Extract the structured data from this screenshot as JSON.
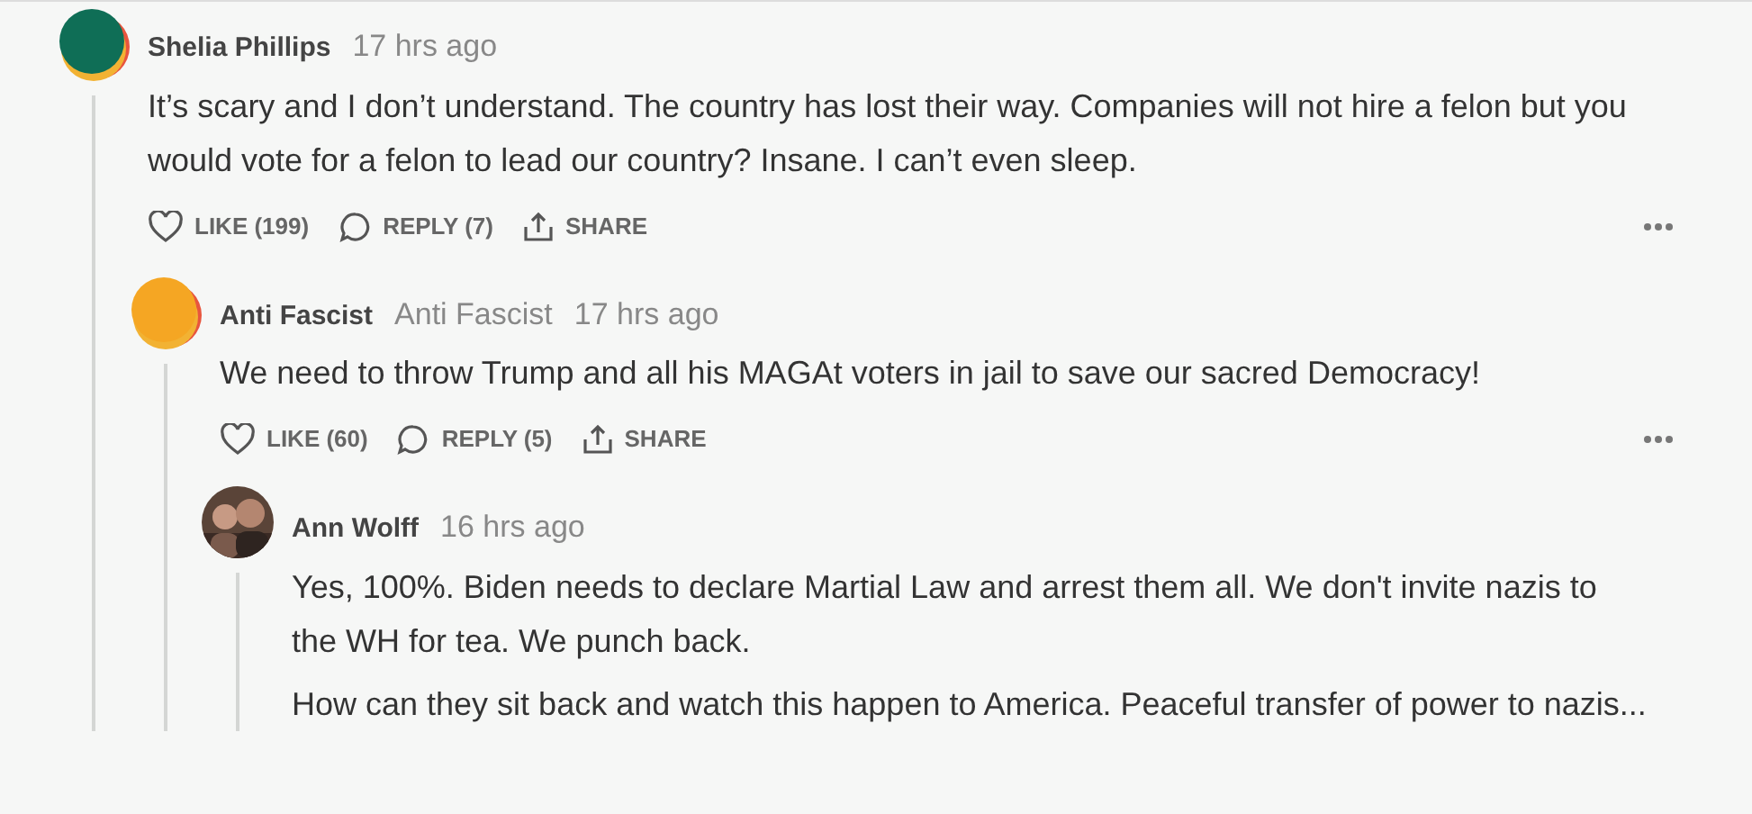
{
  "comments": [
    {
      "author": "Shelia Phillips",
      "time": "17 hrs ago",
      "avatar": {
        "kind": "swatch",
        "color": "#0f6e56"
      },
      "paragraphs": [
        "It’s scary and I don’t understand. The country has lost their way. Companies will not hire a felon but you would vote for a felon to lead our country? Insane. I can’t even sleep."
      ],
      "actions": [
        {
          "kind": "like",
          "label": "LIKE (199)"
        },
        {
          "kind": "reply",
          "label": "REPLY (7)"
        },
        {
          "kind": "share",
          "label": "SHARE"
        }
      ],
      "more": true,
      "children": [
        {
          "author": "Anti Fascist",
          "handle": "Anti Fascist",
          "time": "17 hrs ago",
          "avatar": {
            "kind": "swatch",
            "color": "#f5a623"
          },
          "paragraphs": [
            "We need to throw Trump and all his MAGAt voters in jail to save our sacred Democracy!"
          ],
          "actions": [
            {
              "kind": "like",
              "label": "LIKE (60)"
            },
            {
              "kind": "reply",
              "label": "REPLY (5)"
            },
            {
              "kind": "share",
              "label": "SHARE"
            }
          ],
          "more": true,
          "children": [
            {
              "author": "Ann Wolff",
              "time": "16 hrs ago",
              "avatar": {
                "kind": "picture"
              },
              "paragraphs": [
                "Yes, 100%. Biden needs to declare Martial Law and arrest them all. We don't invite nazis to the WH for tea. We punch back.",
                "How can they sit back and watch this happen to America. Peaceful transfer of power to nazis..."
              ]
            }
          ]
        }
      ]
    }
  ]
}
